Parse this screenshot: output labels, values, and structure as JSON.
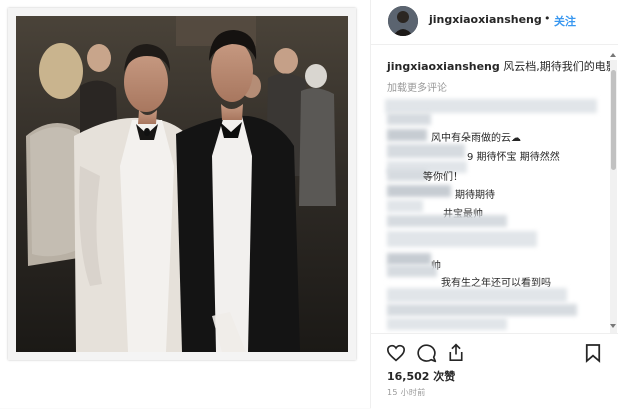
{
  "header": {
    "username": "jingxiaoxiansheng",
    "separator": "•",
    "follow_label": "关注"
  },
  "caption": {
    "username": "jingxiaoxiansheng",
    "text": "风云档,期待我们的电影"
  },
  "load_more": "加载更多评论",
  "comments": [
    {
      "text": "风中有朵雨做的云☁"
    },
    {
      "text": "9 期待怀宝 期待然然"
    },
    {
      "text": "等你们！"
    },
    {
      "text": "期待期待"
    },
    {
      "text": "井宝最帅"
    },
    {
      "text": "帅"
    },
    {
      "text": "我有生之年还可以看到吗"
    }
  ],
  "stats": {
    "likes": "16,502 次赞",
    "time": "15 小时前"
  },
  "icons": {
    "like": "heart-icon",
    "comment": "comment-icon",
    "share": "share-icon",
    "save": "bookmark-icon"
  }
}
